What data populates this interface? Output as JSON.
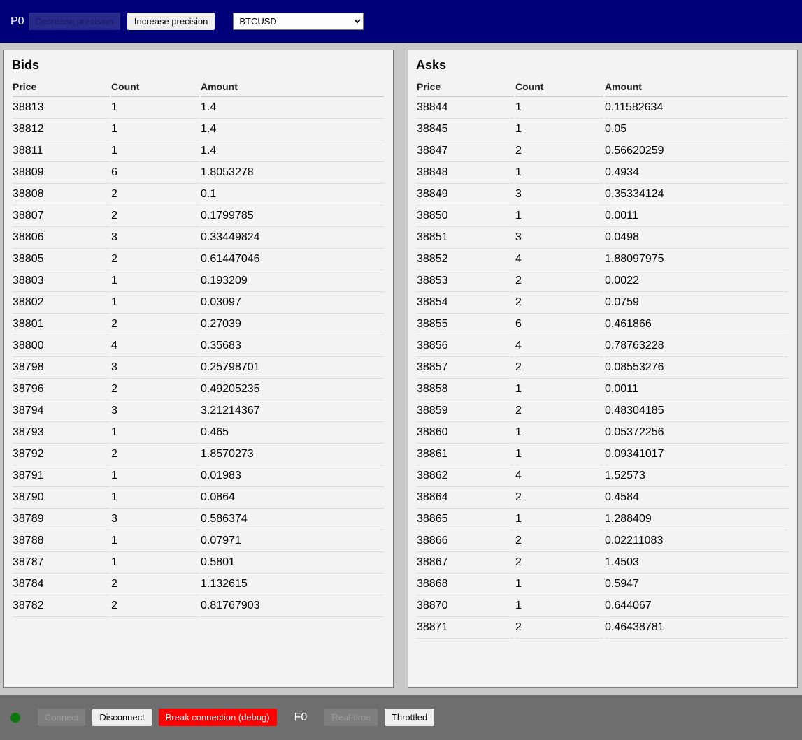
{
  "header": {
    "precision_label": "P0",
    "decrease_precision_label": "Decrease precision",
    "increase_precision_label": "Increase precision",
    "pair_select": {
      "selected": "BTCUSD",
      "options": [
        "BTCUSD"
      ]
    }
  },
  "bids": {
    "title": "Bids",
    "columns": [
      "Price",
      "Count",
      "Amount"
    ],
    "rows": [
      [
        "38813",
        "1",
        "1.4"
      ],
      [
        "38812",
        "1",
        "1.4"
      ],
      [
        "38811",
        "1",
        "1.4"
      ],
      [
        "38809",
        "6",
        "1.8053278"
      ],
      [
        "38808",
        "2",
        "0.1"
      ],
      [
        "38807",
        "2",
        "0.1799785"
      ],
      [
        "38806",
        "3",
        "0.33449824"
      ],
      [
        "38805",
        "2",
        "0.61447046"
      ],
      [
        "38803",
        "1",
        "0.193209"
      ],
      [
        "38802",
        "1",
        "0.03097"
      ],
      [
        "38801",
        "2",
        "0.27039"
      ],
      [
        "38800",
        "4",
        "0.35683"
      ],
      [
        "38798",
        "3",
        "0.25798701"
      ],
      [
        "38796",
        "2",
        "0.49205235"
      ],
      [
        "38794",
        "3",
        "3.21214367"
      ],
      [
        "38793",
        "1",
        "0.465"
      ],
      [
        "38792",
        "2",
        "1.8570273"
      ],
      [
        "38791",
        "1",
        "0.01983"
      ],
      [
        "38790",
        "1",
        "0.0864"
      ],
      [
        "38789",
        "3",
        "0.586374"
      ],
      [
        "38788",
        "1",
        "0.07971"
      ],
      [
        "38787",
        "1",
        "0.5801"
      ],
      [
        "38784",
        "2",
        "1.132615"
      ],
      [
        "38782",
        "2",
        "0.81767903"
      ]
    ]
  },
  "asks": {
    "title": "Asks",
    "columns": [
      "Price",
      "Count",
      "Amount"
    ],
    "rows": [
      [
        "38844",
        "1",
        "0.11582634"
      ],
      [
        "38845",
        "1",
        "0.05"
      ],
      [
        "38847",
        "2",
        "0.56620259"
      ],
      [
        "38848",
        "1",
        "0.4934"
      ],
      [
        "38849",
        "3",
        "0.35334124"
      ],
      [
        "38850",
        "1",
        "0.0011"
      ],
      [
        "38851",
        "3",
        "0.0498"
      ],
      [
        "38852",
        "4",
        "1.88097975"
      ],
      [
        "38853",
        "2",
        "0.0022"
      ],
      [
        "38854",
        "2",
        "0.0759"
      ],
      [
        "38855",
        "6",
        "0.461866"
      ],
      [
        "38856",
        "4",
        "0.78763228"
      ],
      [
        "38857",
        "2",
        "0.08553276"
      ],
      [
        "38858",
        "1",
        "0.0011"
      ],
      [
        "38859",
        "2",
        "0.48304185"
      ],
      [
        "38860",
        "1",
        "0.05372256"
      ],
      [
        "38861",
        "1",
        "0.09341017"
      ],
      [
        "38862",
        "4",
        "1.52573"
      ],
      [
        "38864",
        "2",
        "0.4584"
      ],
      [
        "38865",
        "1",
        "1.288409"
      ],
      [
        "38866",
        "2",
        "0.02211083"
      ],
      [
        "38867",
        "2",
        "1.4503"
      ],
      [
        "38868",
        "1",
        "0.5947"
      ],
      [
        "38870",
        "1",
        "0.644067"
      ],
      [
        "38871",
        "2",
        "0.46438781"
      ]
    ]
  },
  "footer": {
    "status_icon": "connection-status-dot",
    "status_color": "#0b780b",
    "connect_label": "Connect",
    "disconnect_label": "Disconnect",
    "break_connection_label": "Break connection (debug)",
    "frequency_label": "F0",
    "realtime_label": "Real-time",
    "throttled_label": "Throttled"
  },
  "colors": {
    "header_bg": "#000078",
    "footer_bg": "#6e6e6e",
    "break_button": "#ff0000"
  }
}
